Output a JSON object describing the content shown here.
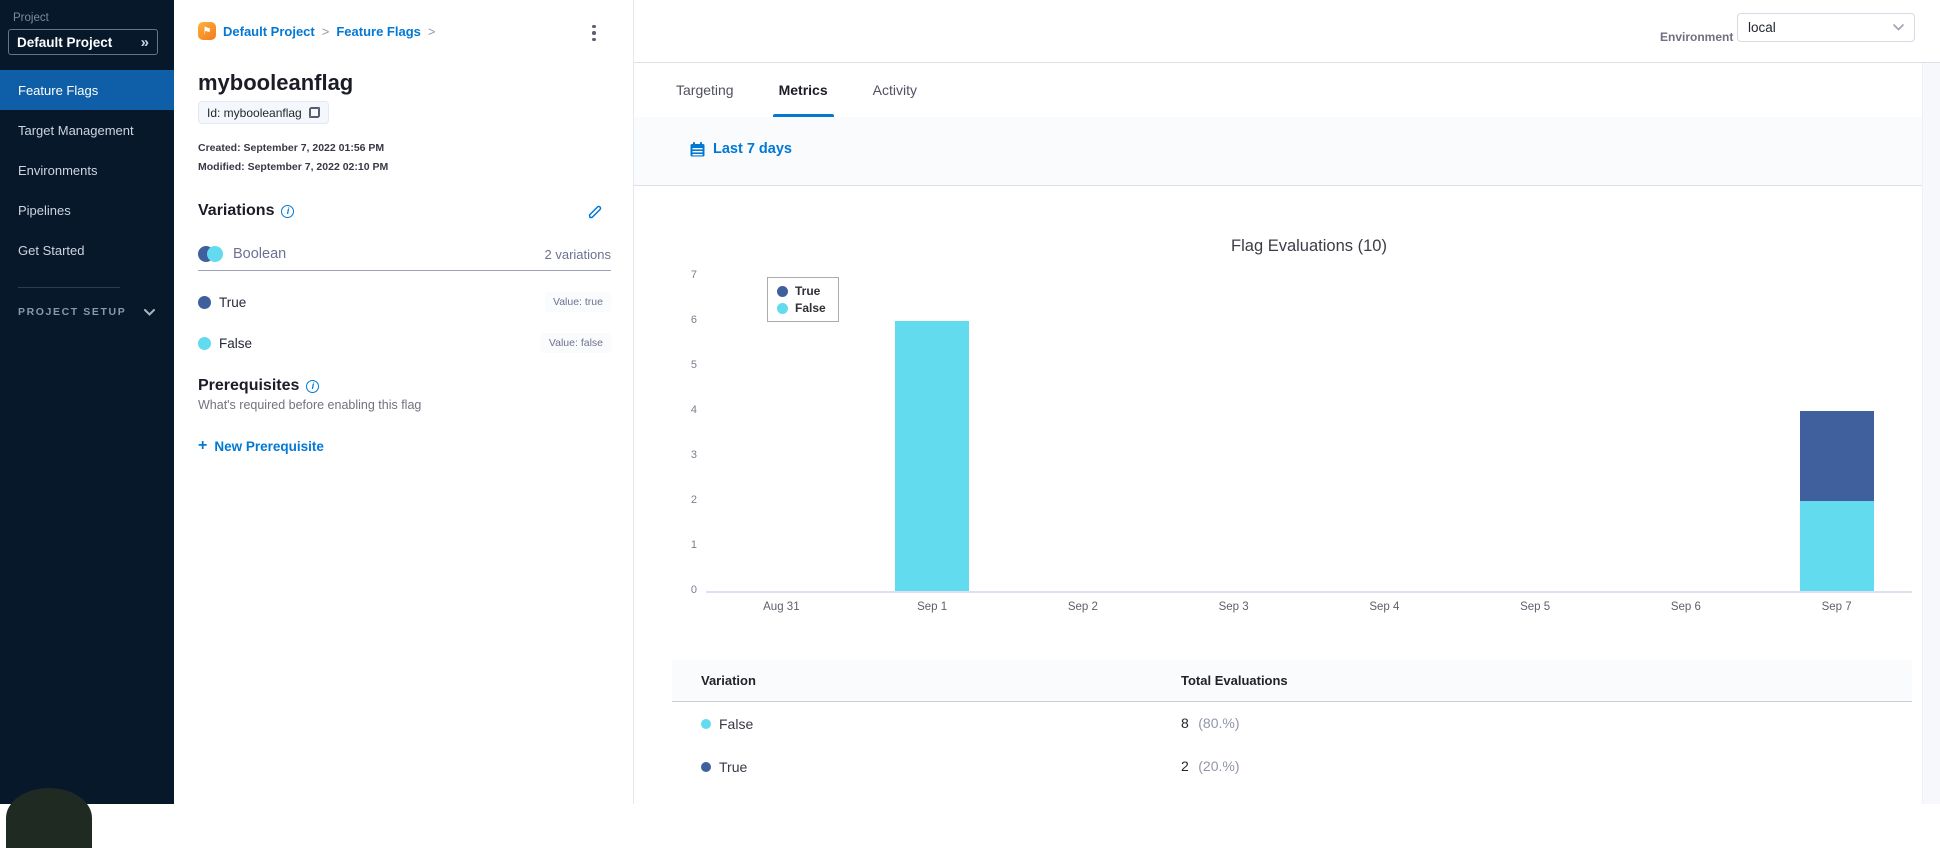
{
  "colors": {
    "sidebar_bg": "#07182b",
    "active_nav": "#0f5fa8",
    "link_blue": "#0278d5",
    "true_blue": "#3f5f9d",
    "false_cyan": "#62dbee"
  },
  "sidebar": {
    "project_label": "Project",
    "project_name": "Default Project",
    "expand_icon": "»",
    "items": [
      {
        "label": "Feature Flags",
        "active": true
      },
      {
        "label": "Target Management",
        "active": false
      },
      {
        "label": "Environments",
        "active": false
      },
      {
        "label": "Pipelines",
        "active": false
      },
      {
        "label": "Get Started",
        "active": false
      }
    ],
    "section_label": "PROJECT SETUP"
  },
  "breadcrumb": {
    "items": [
      "Default Project",
      "Feature Flags"
    ],
    "separator": ">"
  },
  "flag": {
    "title": "mybooleanflag",
    "id_chip": "Id: mybooleanflag",
    "created": "Created: September 7, 2022 01:56 PM",
    "modified": "Modified: September 7, 2022 02:10 PM"
  },
  "variations": {
    "heading": "Variations",
    "type_label": "Boolean",
    "count_label": "2 variations",
    "items": [
      {
        "name": "True",
        "value_label": "Value: true",
        "color": "#3f5f9d"
      },
      {
        "name": "False",
        "value_label": "Value: false",
        "color": "#62dbee"
      }
    ]
  },
  "prerequisites": {
    "heading": "Prerequisites",
    "subtitle": "What's required before enabling this flag",
    "plus": "+",
    "new_button": "New Prerequisite"
  },
  "environment": {
    "label": "Environment",
    "selected": "local"
  },
  "tabs": [
    {
      "label": "Targeting",
      "active": false
    },
    {
      "label": "Metrics",
      "active": true
    },
    {
      "label": "Activity",
      "active": false
    }
  ],
  "date_filter": {
    "label": "Last 7 days"
  },
  "chart_data": {
    "type": "bar",
    "stacked": true,
    "title": "Flag Evaluations (10)",
    "xlabel": "",
    "ylabel": "",
    "categories": [
      "Aug 31",
      "Sep 1",
      "Sep 2",
      "Sep 3",
      "Sep 4",
      "Sep 5",
      "Sep 6",
      "Sep 7"
    ],
    "series": [
      {
        "name": "True",
        "color": "#3f5f9d",
        "values": [
          0,
          0,
          0,
          0,
          0,
          0,
          0,
          2
        ]
      },
      {
        "name": "False",
        "color": "#62dbee",
        "values": [
          0,
          6,
          0,
          0,
          0,
          0,
          0,
          2
        ]
      }
    ],
    "ylim": [
      0,
      7
    ],
    "yticks": [
      0,
      1,
      2,
      3,
      4,
      5,
      6,
      7
    ],
    "legend_position": "top-left",
    "grid": false
  },
  "table": {
    "headers": [
      "Variation",
      "Total Evaluations"
    ],
    "rows": [
      {
        "variation": "False",
        "color": "#62dbee",
        "total": "8",
        "percent": "(80.%)"
      },
      {
        "variation": "True",
        "color": "#3f5f9d",
        "total": "2",
        "percent": "(20.%)"
      }
    ]
  }
}
